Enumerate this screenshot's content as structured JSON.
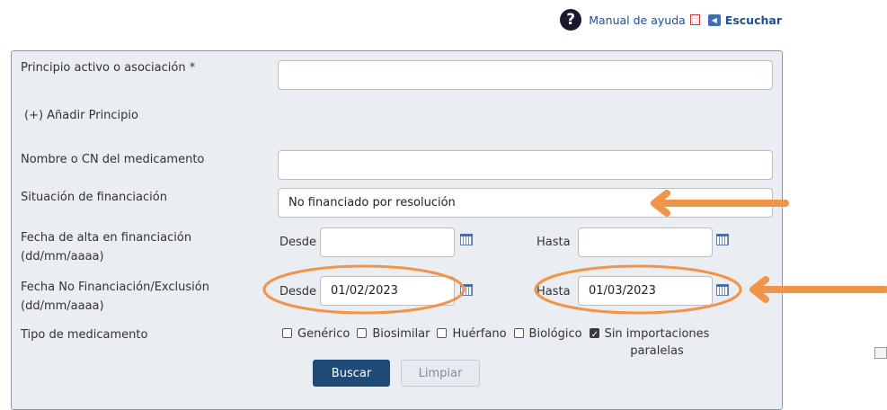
{
  "header": {
    "help_glyph": "?",
    "manual_label": "Manual de ayuda",
    "listen_label": "Escuchar"
  },
  "form": {
    "active_principle_label": "Principio activo o asociación *",
    "active_principle_value": "",
    "add_principle_link": "(+) Añadir Principio",
    "medicine_name_label": "Nombre o CN del medicamento",
    "medicine_name_value": "",
    "financing_status_label": "Situación de financiación",
    "financing_status_value": "No financiado por resolución",
    "financing_date_label": "Fecha de alta en financiación",
    "financing_date_format": "(dd/mm/aaaa)",
    "financing_from_label": "Desde",
    "financing_from_value": "",
    "financing_to_label": "Hasta",
    "financing_to_value": "",
    "exclusion_date_label": "Fecha No Financiación/Exclusión",
    "exclusion_date_format": "(dd/mm/aaaa)",
    "exclusion_from_label": "Desde",
    "exclusion_from_value": "01/02/2023",
    "exclusion_to_label": "Hasta",
    "exclusion_to_value": "01/03/2023",
    "medicine_type_label": "Tipo de medicamento",
    "types": [
      {
        "label": "Genérico",
        "checked": false
      },
      {
        "label": "Biosimilar",
        "checked": false
      },
      {
        "label": "Huérfano",
        "checked": false
      },
      {
        "label": "Biológico",
        "checked": false
      }
    ],
    "parallel_import_line1": "Sin importaciones",
    "parallel_import_line2": "paralelas",
    "parallel_import_checked": true,
    "search_button": "Buscar",
    "clear_button": "Limpiar"
  },
  "annotations": {
    "highlight_color": "#f0944a"
  }
}
